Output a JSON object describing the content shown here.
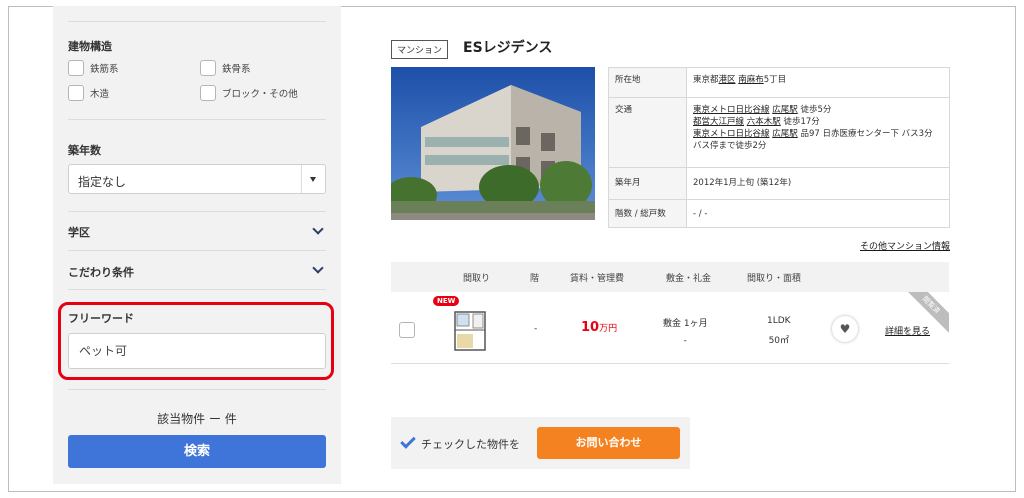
{
  "sidebar": {
    "structure_title": "建物構造",
    "structure_options": [
      "鉄筋系",
      "鉄骨系",
      "木造",
      "ブロック・その他"
    ],
    "age_title": "築年数",
    "age_select_value": "指定なし",
    "school_title": "学区",
    "conditions_title": "こだわり条件",
    "freeword_title": "フリーワード",
    "freeword_value": "ペット可",
    "result_text": "該当物件 ー 件",
    "search_label": "検索"
  },
  "property": {
    "type_tag": "マンション",
    "name": "ESレジデンス",
    "info": {
      "location_label": "所在地",
      "location_prefix": "東京都",
      "location_ward": "港区",
      "location_town": "南麻布",
      "location_suffix": "5丁目",
      "transit_label": "交通",
      "transit_1_line": "東京メトロ日比谷線",
      "transit_1_station": "広尾駅",
      "transit_1_walk": "徒歩5分",
      "transit_2_line": "都営大江戸線",
      "transit_2_station": "六本木駅",
      "transit_2_walk": "徒歩17分",
      "transit_3_line": "東京メトロ日比谷線",
      "transit_3_station": "広尾駅",
      "transit_3_bus": "品97 日赤医療センター下 バス3分 バス停まで徒歩2分",
      "built_label": "築年月",
      "built_value": "2012年1月上旬 (築12年)",
      "floors_label": "階数 / 総戸数",
      "floors_value": "- / -"
    },
    "other_link": "その他マンション情報"
  },
  "rooms": {
    "headers": [
      "間取り",
      "階",
      "賃料・管理費",
      "敷金・礼金",
      "間取り・面積"
    ],
    "row": {
      "badge": "NEW",
      "floor": "-",
      "rent_number": "10",
      "rent_unit": "万円",
      "deposit": "敷金 1ヶ月",
      "key_money": "-",
      "layout": "1LDK",
      "area": "50㎡",
      "heart_icon": "♥",
      "detail_link": "詳細を見る",
      "ribbon": "閲覧済"
    }
  },
  "actions": {
    "check_label": "チェックした物件を",
    "inquiry_label": "お問い合わせ"
  },
  "colors": {
    "accent_blue": "#3f74d9",
    "accent_orange": "#f58220",
    "highlight_red": "#e60012"
  }
}
